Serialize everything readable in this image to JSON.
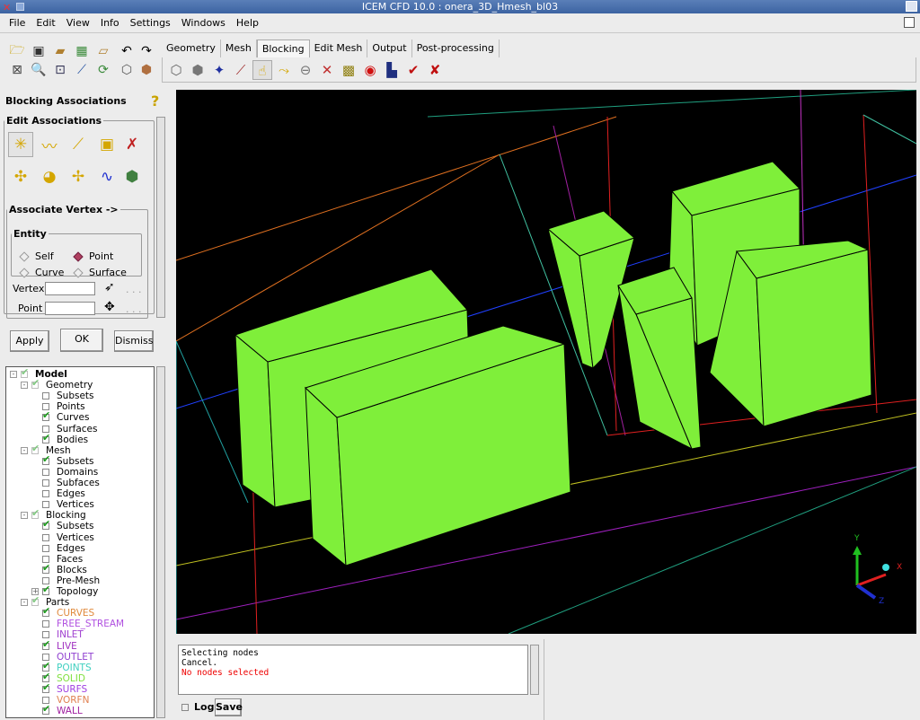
{
  "window": {
    "title": "ICEM CFD 10.0 : onera_3D_Hmesh_bl03"
  },
  "menu": [
    "File",
    "Edit",
    "View",
    "Info",
    "Settings",
    "Windows",
    "Help"
  ],
  "toolbar_icons": [
    "open-folder-icon",
    "save-icon",
    "open-geometry-icon",
    "open-mesh-icon",
    "open-blocking-icon",
    "fit-window-icon",
    "zoom-box-icon",
    "measure-icon",
    "distance-icon",
    "refresh-icon",
    "undo-icon",
    "redo-icon",
    "wireframe-icon",
    "solid-icon"
  ],
  "tabs": [
    {
      "label": "Geometry",
      "active": false
    },
    {
      "label": "Mesh",
      "active": false
    },
    {
      "label": "Blocking",
      "active": true
    },
    {
      "label": "Edit Mesh",
      "active": false
    },
    {
      "label": "Output",
      "active": false
    },
    {
      "label": "Post-processing",
      "active": false
    }
  ],
  "blocking_tools": [
    "create-block-icon",
    "split-block-icon",
    "vertex-icon",
    "edit-edge-icon",
    "associate-icon",
    "move-vertex-icon",
    "transform-icon",
    "edit-block-icon",
    "pre-mesh-params-icon",
    "quality-icon",
    "pre-mesh-smooth-icon",
    "check-block-icon",
    "delete-block-icon"
  ],
  "panel": {
    "title": "Blocking Associations",
    "edit_associations": "Edit Associations",
    "associate_vertex": "Associate Vertex ->",
    "entity": "Entity",
    "options": [
      {
        "label": "Self",
        "selected": false
      },
      {
        "label": "Point",
        "selected": true
      },
      {
        "label": "Curve",
        "selected": false
      },
      {
        "label": "Surface",
        "selected": false
      }
    ],
    "vertex_label": "Vertex",
    "vertex_value": "",
    "point_label": "Point",
    "point_value": "",
    "dots": ". . .",
    "apply": "Apply",
    "ok": "OK",
    "dismiss": "Dismiss"
  },
  "tree": [
    {
      "label": "Model",
      "level": 0,
      "checked": "partial",
      "expander": "-",
      "bold": true
    },
    {
      "label": "Geometry",
      "level": 1,
      "checked": "partial",
      "expander": "-"
    },
    {
      "label": "Subsets",
      "level": 2,
      "checked": false
    },
    {
      "label": "Points",
      "level": 2,
      "checked": false
    },
    {
      "label": "Curves",
      "level": 2,
      "checked": true
    },
    {
      "label": "Surfaces",
      "level": 2,
      "checked": false
    },
    {
      "label": "Bodies",
      "level": 2,
      "checked": true
    },
    {
      "label": "Mesh",
      "level": 1,
      "checked": "partial",
      "expander": "-"
    },
    {
      "label": "Subsets",
      "level": 2,
      "checked": true
    },
    {
      "label": "Domains",
      "level": 2,
      "checked": false
    },
    {
      "label": "Subfaces",
      "level": 2,
      "checked": false
    },
    {
      "label": "Edges",
      "level": 2,
      "checked": false
    },
    {
      "label": "Vertices",
      "level": 2,
      "checked": false
    },
    {
      "label": "Blocking",
      "level": 1,
      "checked": "partial",
      "expander": "-"
    },
    {
      "label": "Subsets",
      "level": 2,
      "checked": true
    },
    {
      "label": "Vertices",
      "level": 2,
      "checked": false
    },
    {
      "label": "Edges",
      "level": 2,
      "checked": false
    },
    {
      "label": "Faces",
      "level": 2,
      "checked": false
    },
    {
      "label": "Blocks",
      "level": 2,
      "checked": true
    },
    {
      "label": "Pre-Mesh",
      "level": 2,
      "checked": false
    },
    {
      "label": "Topology",
      "level": 2,
      "checked": true,
      "expander": "+"
    },
    {
      "label": "Parts",
      "level": 1,
      "checked": "partial",
      "expander": "-"
    },
    {
      "label": "CURVES",
      "level": 2,
      "checked": true,
      "color": "#e08a3c"
    },
    {
      "label": "FREE_STREAM",
      "level": 2,
      "checked": false,
      "color": "#b050e0"
    },
    {
      "label": "INLET",
      "level": 2,
      "checked": false,
      "color": "#a040d0"
    },
    {
      "label": "LIVE",
      "level": 2,
      "checked": true,
      "color": "#a030c0"
    },
    {
      "label": "OUTLET",
      "level": 2,
      "checked": false,
      "color": "#9040d0"
    },
    {
      "label": "POINTS",
      "level": 2,
      "checked": true,
      "color": "#40d0c0"
    },
    {
      "label": "SOLID",
      "level": 2,
      "checked": true,
      "color": "#80e040"
    },
    {
      "label": "SURFS",
      "level": 2,
      "checked": true,
      "color": "#a040e0"
    },
    {
      "label": "VORFN",
      "level": 2,
      "checked": false,
      "color": "#e08050"
    },
    {
      "label": "WALL",
      "level": 2,
      "checked": true,
      "color": "#a020a0"
    }
  ],
  "axes": {
    "x": "X",
    "y": "Y",
    "z": "Z"
  },
  "colors": {
    "solid": "#7fef3a",
    "background": "#000000",
    "x_axis": "#e02020",
    "y_axis": "#20c020",
    "z_axis": "#2030d0"
  },
  "log": {
    "lines": [
      "Selecting nodes",
      "Cancel."
    ],
    "error": "No nodes selected",
    "log_label": "Log",
    "save": "Save"
  }
}
